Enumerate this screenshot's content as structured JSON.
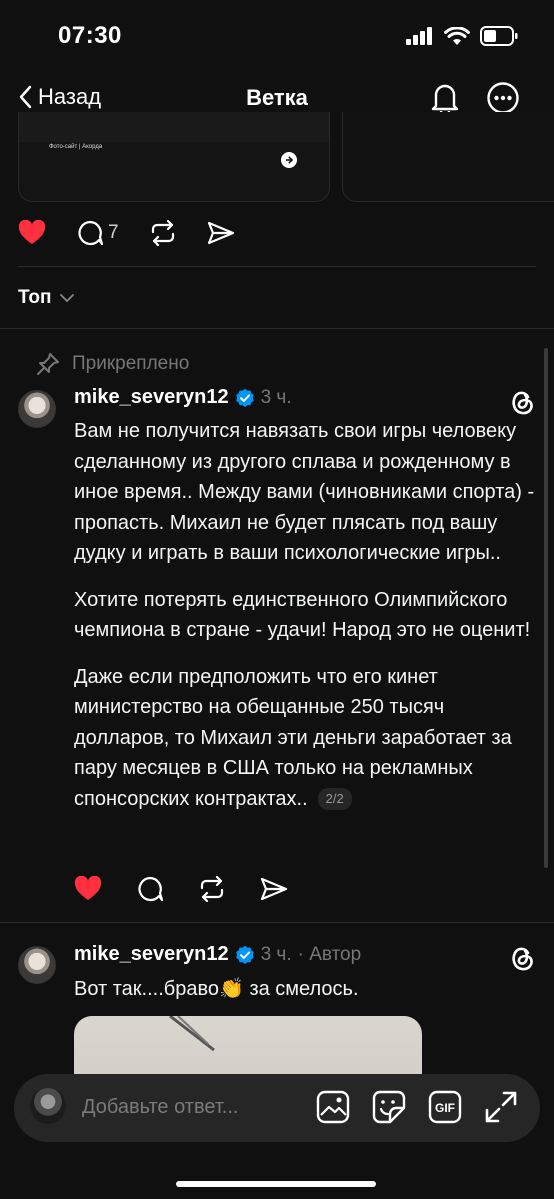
{
  "status_bar": {
    "time": "07:30"
  },
  "nav": {
    "back_label": "Назад",
    "title": "Ветка"
  },
  "top_post": {
    "card_caption": "Фото-сайт | Акорда",
    "comment_count": "7"
  },
  "sort": {
    "label": "Топ"
  },
  "pinned_label": "Прикреплено",
  "main_reply": {
    "username": "mike_severyn12",
    "time": "3 ч.",
    "paragraphs": [
      "Вам не получится навязать свои игры человеку сделанному из другого сплава и рожденному в иное время.. Между вами (чиновниками спорта) - пропасть. Михаил не будет плясать под вашу дудку и играть в ваши психологические игры..",
      "Хотите потерять единственного Олимпийского чемпиона в стране - удачи! Народ это не оценит!",
      " Даже если предположить что его кинет министерство на обещанные 250 тысяч долларов, то Михаил эти деньги заработает за пару месяцев в США только на рекламных спонсорских контрактах.."
    ],
    "pager": "2/2"
  },
  "second_reply": {
    "username": "mike_severyn12",
    "time": "3 ч.",
    "author_label": "· Автор",
    "text": "Вот так....браво👏 за смелось."
  },
  "composer": {
    "placeholder": "Добавьте ответ..."
  },
  "colors": {
    "like": "#ff3040",
    "background": "#101010",
    "verified": "#0095f6"
  }
}
